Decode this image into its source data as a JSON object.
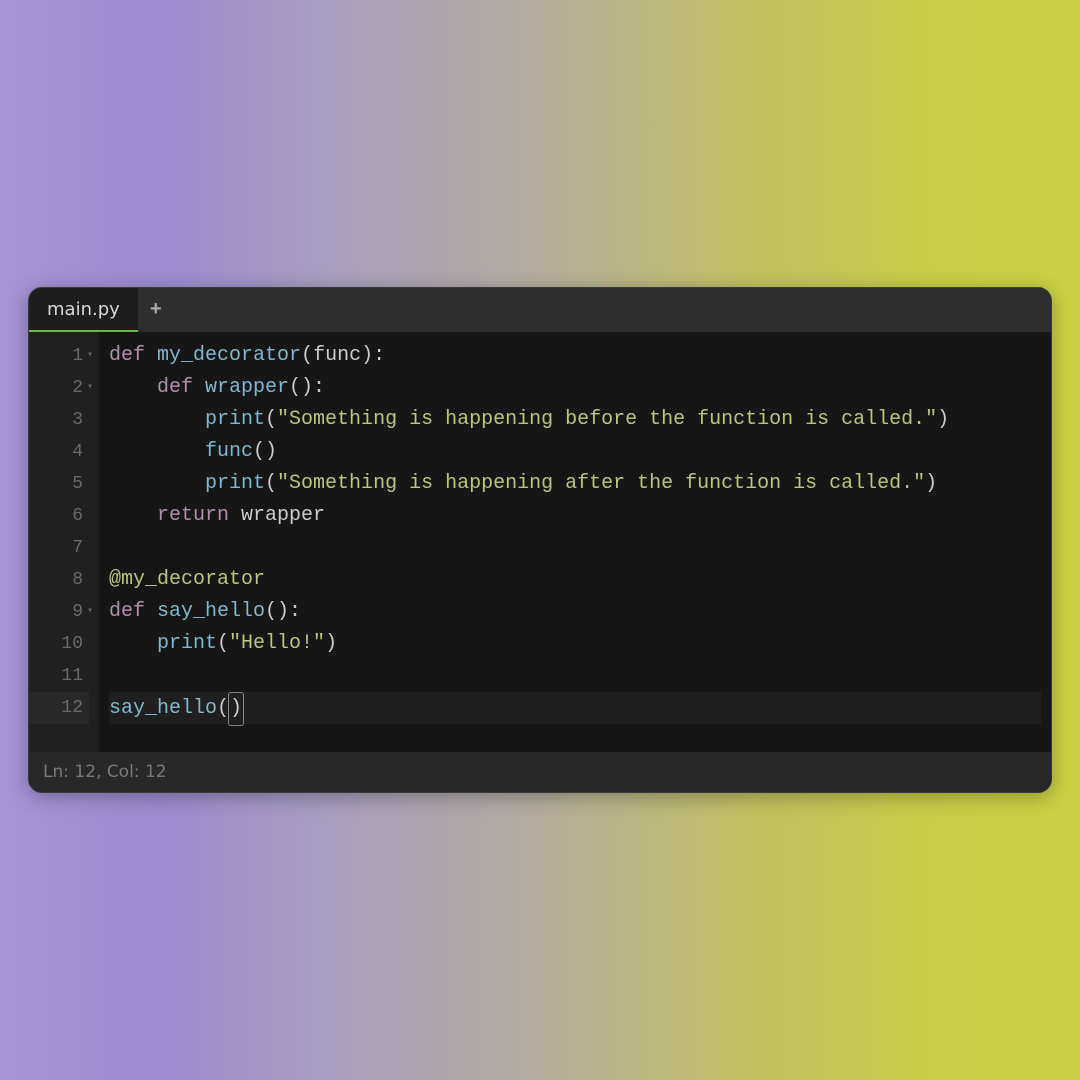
{
  "tabs": {
    "active": "main.py",
    "new_tab_icon": "+"
  },
  "status": {
    "line_col": "Ln: 12,  Col: 12"
  },
  "code": {
    "lines": [
      {
        "num": "1",
        "fold": true,
        "indent": 0,
        "tokens": [
          {
            "t": "def ",
            "c": "kw"
          },
          {
            "t": "my_decorator",
            "c": "fn"
          },
          {
            "t": "(",
            "c": "paren"
          },
          {
            "t": "func",
            "c": "param"
          },
          {
            "t": "):",
            "c": "paren"
          }
        ]
      },
      {
        "num": "2",
        "fold": true,
        "indent": 1,
        "tokens": [
          {
            "t": "    ",
            "c": ""
          },
          {
            "t": "def ",
            "c": "kw"
          },
          {
            "t": "wrapper",
            "c": "fn"
          },
          {
            "t": "():",
            "c": "paren"
          }
        ]
      },
      {
        "num": "3",
        "fold": false,
        "indent": 2,
        "tokens": [
          {
            "t": "        ",
            "c": ""
          },
          {
            "t": "print",
            "c": "fn-call"
          },
          {
            "t": "(",
            "c": "paren"
          },
          {
            "t": "\"Something is happening before the function is called.\"",
            "c": "str"
          },
          {
            "t": ")",
            "c": "paren"
          }
        ]
      },
      {
        "num": "4",
        "fold": false,
        "indent": 2,
        "tokens": [
          {
            "t": "        ",
            "c": ""
          },
          {
            "t": "func",
            "c": "fn-call"
          },
          {
            "t": "()",
            "c": "paren"
          }
        ]
      },
      {
        "num": "5",
        "fold": false,
        "indent": 2,
        "tokens": [
          {
            "t": "        ",
            "c": ""
          },
          {
            "t": "print",
            "c": "fn-call"
          },
          {
            "t": "(",
            "c": "paren"
          },
          {
            "t": "\"Something is happening after the function is called.\"",
            "c": "str"
          },
          {
            "t": ")",
            "c": "paren"
          }
        ]
      },
      {
        "num": "6",
        "fold": false,
        "indent": 1,
        "tokens": [
          {
            "t": "    ",
            "c": ""
          },
          {
            "t": "return ",
            "c": "kw"
          },
          {
            "t": "wrapper",
            "c": "param"
          }
        ]
      },
      {
        "num": "7",
        "fold": false,
        "indent": 0,
        "tokens": []
      },
      {
        "num": "8",
        "fold": false,
        "indent": 0,
        "tokens": [
          {
            "t": "@my_decorator",
            "c": "dec"
          }
        ]
      },
      {
        "num": "9",
        "fold": true,
        "indent": 0,
        "tokens": [
          {
            "t": "def ",
            "c": "kw"
          },
          {
            "t": "say_hello",
            "c": "fn"
          },
          {
            "t": "():",
            "c": "paren"
          }
        ]
      },
      {
        "num": "10",
        "fold": false,
        "indent": 1,
        "tokens": [
          {
            "t": "    ",
            "c": ""
          },
          {
            "t": "print",
            "c": "fn-call"
          },
          {
            "t": "(",
            "c": "paren"
          },
          {
            "t": "\"Hello!\"",
            "c": "str"
          },
          {
            "t": ")",
            "c": "paren"
          }
        ]
      },
      {
        "num": "11",
        "fold": false,
        "indent": 0,
        "tokens": []
      },
      {
        "num": "12",
        "fold": false,
        "indent": 0,
        "active": true,
        "tokens": [
          {
            "t": "say_hello",
            "c": "fn-call"
          },
          {
            "t": "(",
            "c": "paren"
          },
          {
            "t": ")",
            "c": "paren cursor"
          }
        ]
      }
    ]
  }
}
